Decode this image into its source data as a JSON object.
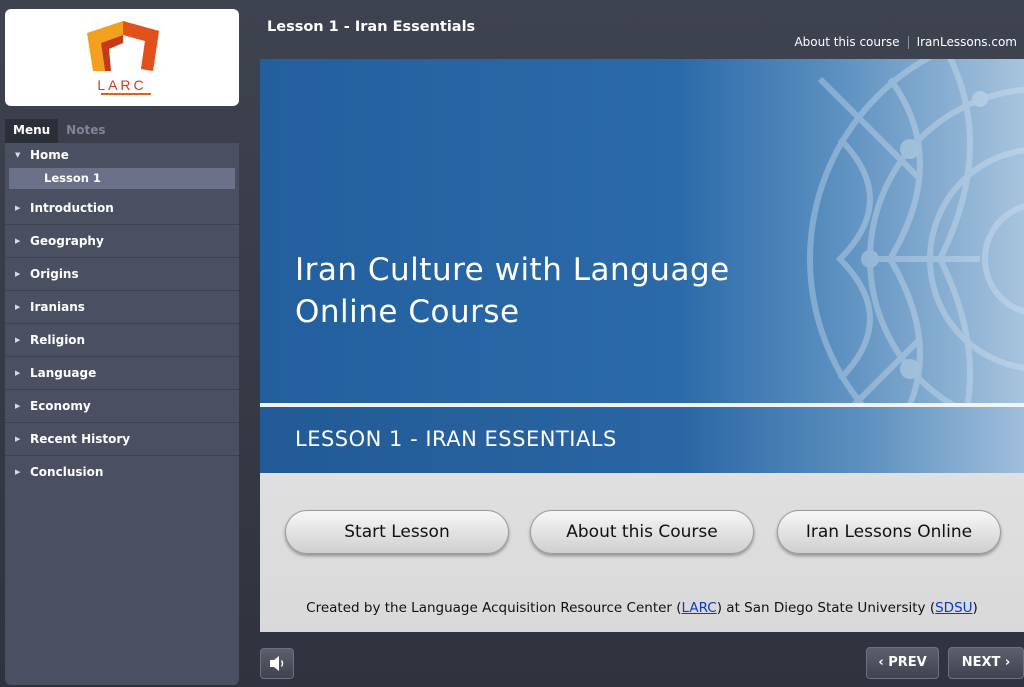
{
  "sidebar": {
    "logo_text": "LARC",
    "tabs": [
      "Menu",
      "Notes"
    ],
    "home": {
      "label": "Home",
      "icon": "triangle-down"
    },
    "active_item": "Lesson 1",
    "items": [
      {
        "label": "Introduction",
        "icon": "triangle-right"
      },
      {
        "label": "Geography",
        "icon": "triangle-right"
      },
      {
        "label": "Origins",
        "icon": "triangle-right"
      },
      {
        "label": "Iranians",
        "icon": "triangle-right"
      },
      {
        "label": "Religion",
        "icon": "triangle-right"
      },
      {
        "label": "Language",
        "icon": "triangle-right"
      },
      {
        "label": "Economy",
        "icon": "triangle-right"
      },
      {
        "label": "Recent History",
        "icon": "triangle-right"
      },
      {
        "label": "Conclusion",
        "icon": "triangle-right"
      }
    ]
  },
  "header": {
    "lesson_title": "Lesson 1 - Iran Essentials",
    "links": [
      "About this course",
      "IranLessons.com"
    ]
  },
  "main": {
    "course_title": "Iran Culture with Language Online Course",
    "lesson_subtitle": "LESSON 1 - IRAN ESSENTIALS",
    "buttons": [
      "Start Lesson",
      "About this Course",
      "Iran Lessons Online"
    ],
    "credits": {
      "before": "Created by the Language Acquisition Resource Center (",
      "larc": "LARC",
      "middle": ") at San Diego State University (",
      "sdsu": "SDSU",
      "after": ")"
    }
  },
  "footer": {
    "sound_icon": "speaker-icon",
    "prev": "PREV",
    "next": "NEXT"
  },
  "colors": {
    "banner_blue": "#2b6aa9",
    "sidebar_panel": "#4a5061",
    "active_item": "#6a7189",
    "link_blue": "#0a3bc4",
    "logo_orange": "#e0601c"
  }
}
